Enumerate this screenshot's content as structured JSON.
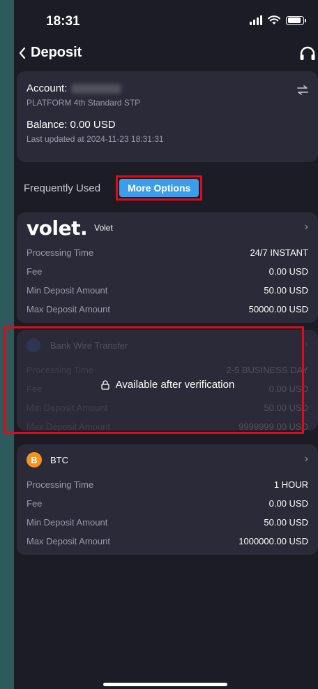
{
  "status_bar": {
    "time": "18:31"
  },
  "nav": {
    "title": "Deposit"
  },
  "account": {
    "label": "Account:",
    "platform": "PLATFORM 4th Standard STP",
    "balance": "Balance: 0.00 USD",
    "updated": "Last updated at 2024-11-23 18:31:31"
  },
  "tabs": {
    "frequent": "Frequently Used",
    "more": "More Options"
  },
  "methods": [
    {
      "name": "Volet",
      "logo": "volet.",
      "rows": [
        {
          "label": "Processing Time",
          "value": "24/7 INSTANT"
        },
        {
          "label": "Fee",
          "value": "0.00 USD"
        },
        {
          "label": "Min Deposit Amount",
          "value": "50.00 USD"
        },
        {
          "label": "Max Deposit Amount",
          "value": "50000.00 USD"
        }
      ]
    },
    {
      "name": "Bank Wire Transfer",
      "locked_text": "Available after verification",
      "rows": [
        {
          "label": "Processing Time",
          "value": "2-5 BUSINESS DAY"
        },
        {
          "label": "Fee",
          "value": "0.00 USD"
        },
        {
          "label": "Min Deposit Amount",
          "value": "50.00 USD"
        },
        {
          "label": "Max Deposit Amount",
          "value": "9999999.00 USD"
        }
      ]
    },
    {
      "name": "BTC",
      "icon_glyph": "B",
      "rows": [
        {
          "label": "Processing Time",
          "value": "1 HOUR"
        },
        {
          "label": "Fee",
          "value": "0.00 USD"
        },
        {
          "label": "Min Deposit Amount",
          "value": "50.00 USD"
        },
        {
          "label": "Max Deposit Amount",
          "value": "1000000.00 USD"
        }
      ]
    }
  ],
  "colors": {
    "background": "#1c1c26",
    "card": "#2a2a38",
    "accent": "#3b9eea",
    "highlight": "#e00a18",
    "btc": "#f7931a"
  },
  "icons": [
    "signal-icon",
    "wifi-icon",
    "battery-icon",
    "chevron-left-icon",
    "headset-icon",
    "switch-icon",
    "chevron-right-icon",
    "globe-icon",
    "lock-icon",
    "btc-icon"
  ]
}
